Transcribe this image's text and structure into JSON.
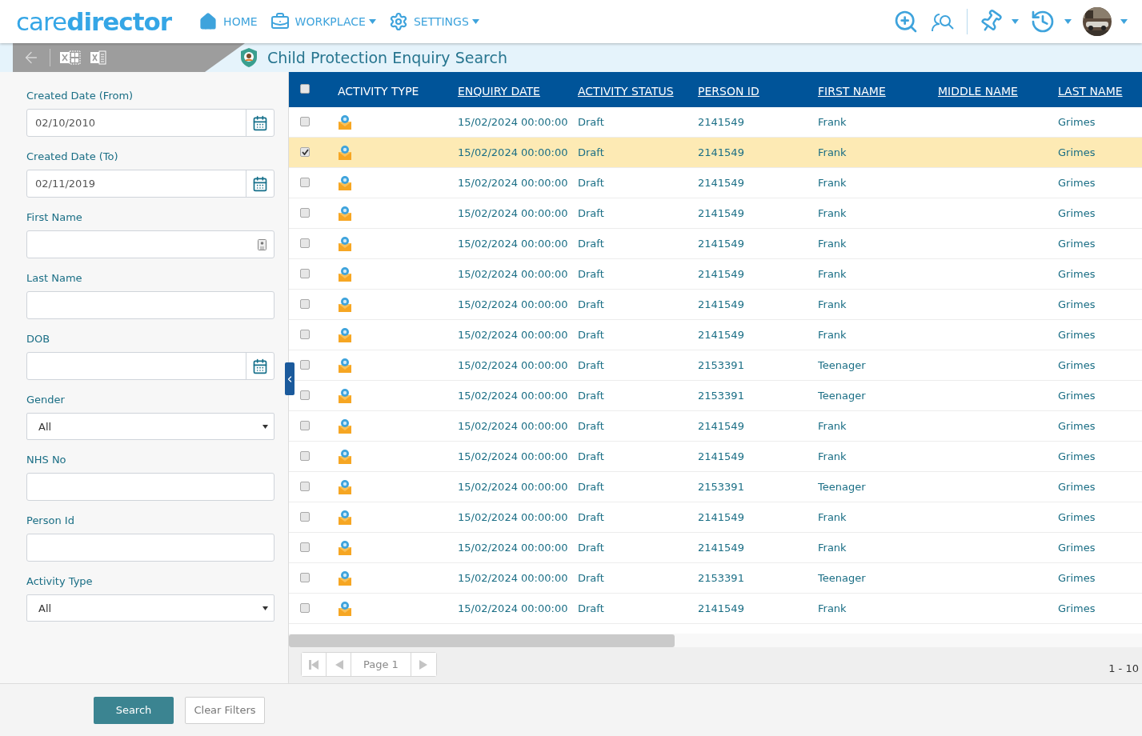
{
  "header": {
    "logo": "care**director**",
    "nav": [
      {
        "label": "HOME",
        "kind": "home",
        "dropdown": false
      },
      {
        "label": "WORKPLACE",
        "kind": "briefcase",
        "dropdown": true
      },
      {
        "label": "SETTINGS",
        "kind": "gear",
        "dropdown": true
      }
    ]
  },
  "page": {
    "title": "Child Protection Enquiry Search"
  },
  "filters": [
    {
      "label": "Created Date (From)",
      "kind": "date",
      "value": "02/10/2010"
    },
    {
      "label": "Created Date (To)",
      "kind": "date",
      "value": "02/11/2019"
    },
    {
      "label": "First Name",
      "kind": "contact"
    },
    {
      "label": "Last Name",
      "kind": "text"
    },
    {
      "label": "DOB",
      "kind": "date"
    },
    {
      "label": "Gender",
      "kind": "select",
      "value": "All"
    },
    {
      "label": "NHS No",
      "kind": "text"
    },
    {
      "label": "Person Id",
      "kind": "text"
    },
    {
      "label": "Activity Type",
      "kind": "select",
      "value": "All"
    }
  ],
  "buttons": {
    "search": "Search",
    "clear": "Clear Filters"
  },
  "table": {
    "select_all_checked": false,
    "columns": [
      {
        "label": "ACTIVITY TYPE",
        "sortable": false
      },
      {
        "label": "ENQUIRY DATE",
        "sortable": true
      },
      {
        "label": "ACTIVITY STATUS",
        "sortable": true
      },
      {
        "label": "PERSON ID",
        "sortable": true
      },
      {
        "label": "FIRST NAME",
        "sortable": true
      },
      {
        "label": "MIDDLE NAME",
        "sortable": true
      },
      {
        "label": "LAST NAME",
        "sortable": true
      }
    ],
    "rows": [
      {
        "selected": false,
        "enquiry_date": "15/02/2024 00:00:00",
        "status": "Draft",
        "person_id": "2141549",
        "first_name": "Frank",
        "last_name": "Grimes"
      },
      {
        "selected": true,
        "enquiry_date": "15/02/2024 00:00:00",
        "status": "Draft",
        "person_id": "2141549",
        "first_name": "Frank",
        "last_name": "Grimes"
      },
      {
        "selected": false,
        "enquiry_date": "15/02/2024 00:00:00",
        "status": "Draft",
        "person_id": "2141549",
        "first_name": "Frank",
        "last_name": "Grimes"
      },
      {
        "selected": false,
        "enquiry_date": "15/02/2024 00:00:00",
        "status": "Draft",
        "person_id": "2141549",
        "first_name": "Frank",
        "last_name": "Grimes"
      },
      {
        "selected": false,
        "enquiry_date": "15/02/2024 00:00:00",
        "status": "Draft",
        "person_id": "2141549",
        "first_name": "Frank",
        "last_name": "Grimes"
      },
      {
        "selected": false,
        "enquiry_date": "15/02/2024 00:00:00",
        "status": "Draft",
        "person_id": "2141549",
        "first_name": "Frank",
        "last_name": "Grimes"
      },
      {
        "selected": false,
        "enquiry_date": "15/02/2024 00:00:00",
        "status": "Draft",
        "person_id": "2141549",
        "first_name": "Frank",
        "last_name": "Grimes"
      },
      {
        "selected": false,
        "enquiry_date": "15/02/2024 00:00:00",
        "status": "Draft",
        "person_id": "2141549",
        "first_name": "Frank",
        "last_name": "Grimes"
      },
      {
        "selected": false,
        "enquiry_date": "15/02/2024 00:00:00",
        "status": "Draft",
        "person_id": "2153391",
        "first_name": "Teenager",
        "last_name": "Grimes"
      },
      {
        "selected": false,
        "enquiry_date": "15/02/2024 00:00:00",
        "status": "Draft",
        "person_id": "2153391",
        "first_name": "Teenager",
        "last_name": "Grimes"
      },
      {
        "selected": false,
        "enquiry_date": "15/02/2024 00:00:00",
        "status": "Draft",
        "person_id": "2141549",
        "first_name": "Frank",
        "last_name": "Grimes"
      },
      {
        "selected": false,
        "enquiry_date": "15/02/2024 00:00:00",
        "status": "Draft",
        "person_id": "2141549",
        "first_name": "Frank",
        "last_name": "Grimes"
      },
      {
        "selected": false,
        "enquiry_date": "15/02/2024 00:00:00",
        "status": "Draft",
        "person_id": "2153391",
        "first_name": "Teenager",
        "last_name": "Grimes"
      },
      {
        "selected": false,
        "enquiry_date": "15/02/2024 00:00:00",
        "status": "Draft",
        "person_id": "2141549",
        "first_name": "Frank",
        "last_name": "Grimes"
      },
      {
        "selected": false,
        "enquiry_date": "15/02/2024 00:00:00",
        "status": "Draft",
        "person_id": "2141549",
        "first_name": "Frank",
        "last_name": "Grimes"
      },
      {
        "selected": false,
        "enquiry_date": "15/02/2024 00:00:00",
        "status": "Draft",
        "person_id": "2153391",
        "first_name": "Teenager",
        "last_name": "Grimes"
      },
      {
        "selected": false,
        "enquiry_date": "15/02/2024 00:00:00",
        "status": "Draft",
        "person_id": "2141549",
        "first_name": "Frank",
        "last_name": "Grimes"
      }
    ]
  },
  "pager": {
    "page": "Page 1",
    "range": "1 - 10"
  }
}
